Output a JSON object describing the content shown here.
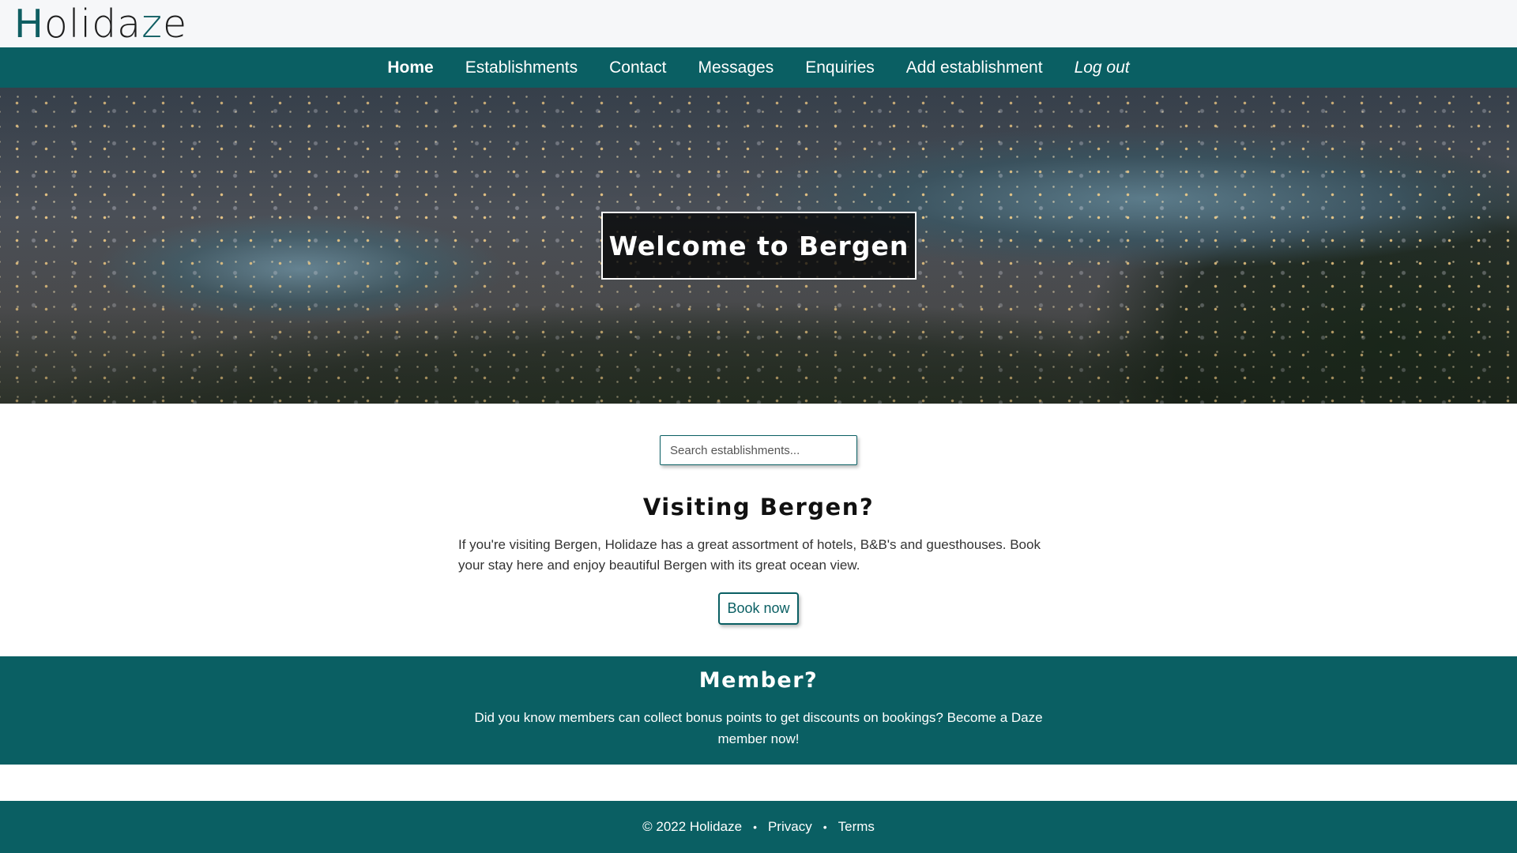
{
  "brand": {
    "logo_first": "H",
    "logo_mid": "olida",
    "logo_z": "z",
    "logo_end": "e"
  },
  "nav": {
    "items": [
      {
        "label": "Home"
      },
      {
        "label": "Establishments"
      },
      {
        "label": "Contact"
      },
      {
        "label": "Messages"
      },
      {
        "label": "Enquiries"
      },
      {
        "label": "Add establishment"
      },
      {
        "label": "Log out"
      }
    ]
  },
  "hero": {
    "title": "Welcome to Bergen"
  },
  "search": {
    "placeholder": "Search establishments..."
  },
  "visiting": {
    "title": "Visiting Bergen?",
    "text": "If you're visiting Bergen, Holidaze has a great assortment of hotels, B&B's and guesthouses. Book your stay here and enjoy beautiful Bergen with its great ocean view.",
    "button": "Book now"
  },
  "member": {
    "title": "Member?",
    "text": "Did you know members can collect bonus points to get discounts on bookings? Become a Daze member now!"
  },
  "footer": {
    "copyright": "© 2022 Holidaze",
    "separator": "•",
    "privacy": "Privacy",
    "terms": "Terms"
  },
  "colors": {
    "brand": "#0a5f63",
    "topbar": "#f6f7f9"
  }
}
